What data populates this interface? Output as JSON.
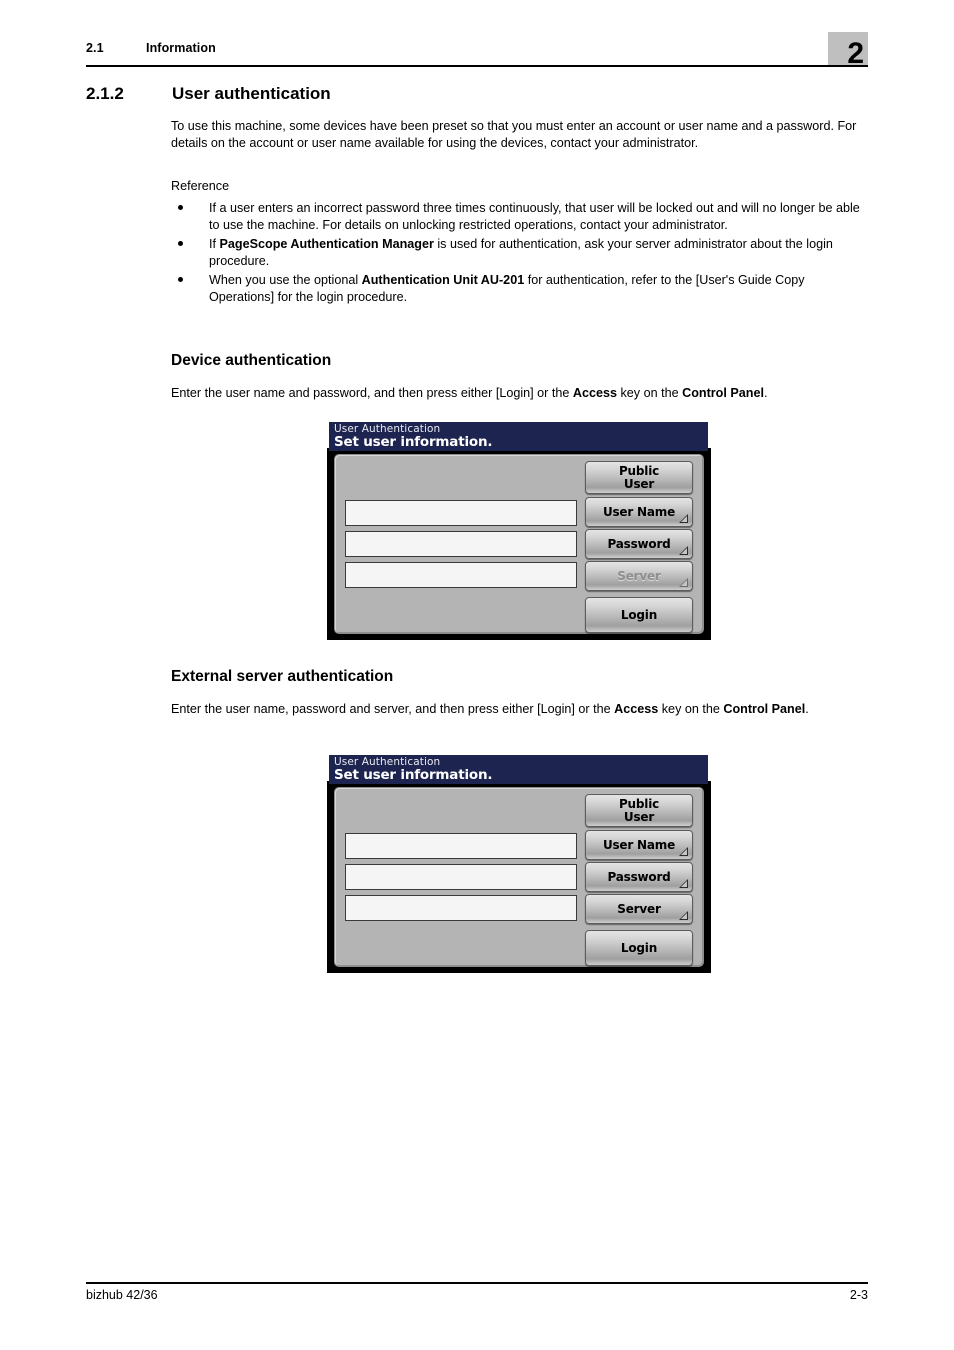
{
  "header": {
    "section_number": "2.1",
    "section_title": "Information",
    "chapter_tab": "2"
  },
  "heading": {
    "number": "2.1.2",
    "title": "User authentication"
  },
  "intro": {
    "paragraph": "To use this machine, some devices have been preset so that you must enter an account or user name and a password. For details on the account or user name available for using the devices, contact your administrator.",
    "reference_label": "Reference"
  },
  "bullets": [
    {
      "pre": "If a user enters an incorrect password three times continuously, that user will be locked out and will no longer be able to use the machine. For details on unlocking restricted operations, contact your administrator.",
      "bold": "",
      "post": ""
    },
    {
      "pre": "If ",
      "bold": "PageScope Authentication Manager",
      "post": " is used for authentication, ask your server administrator about the login procedure."
    },
    {
      "pre": "When you use the optional ",
      "bold": "Authentication Unit AU-201",
      "post": " for authentication, refer to the [User's Guide Copy Operations] for the login procedure."
    }
  ],
  "device_auth": {
    "heading": "Device authentication",
    "text_pre": "Enter the user name and password, and then press either [Login] or the ",
    "text_bold1": "Access",
    "text_mid": " key on the ",
    "text_bold2": "Control Panel",
    "text_post": "."
  },
  "external_auth": {
    "heading": "External server authentication",
    "text_pre": "Enter the user name, password and server, and then press either [Login] or the ",
    "text_bold1": "Access",
    "text_mid": " key on the ",
    "text_bold2": "Control Panel",
    "text_post": "."
  },
  "lcd_device": {
    "title_small": "User Authentication",
    "title_big": "Set user information.",
    "buttons": {
      "public_line1": "Public",
      "public_line2": "User",
      "user_name": "User Name",
      "password": "Password",
      "server": "Server",
      "login": "Login"
    },
    "fields": [
      "",
      "",
      ""
    ],
    "server_enabled": false
  },
  "lcd_external": {
    "title_small": "User Authentication",
    "title_big": "Set user information.",
    "buttons": {
      "public_line1": "Public",
      "public_line2": "User",
      "user_name": "User Name",
      "password": "Password",
      "server": "Server",
      "login": "Login"
    },
    "fields": [
      "",
      "",
      ""
    ],
    "server_enabled": true
  },
  "footer": {
    "left": "bizhub 42/36",
    "right": "2-3"
  },
  "colors": {
    "lcd_titlebar": "#1d2450",
    "lcd_body": "#b4b4b4",
    "chapter_tab": "#bfbfbf"
  }
}
